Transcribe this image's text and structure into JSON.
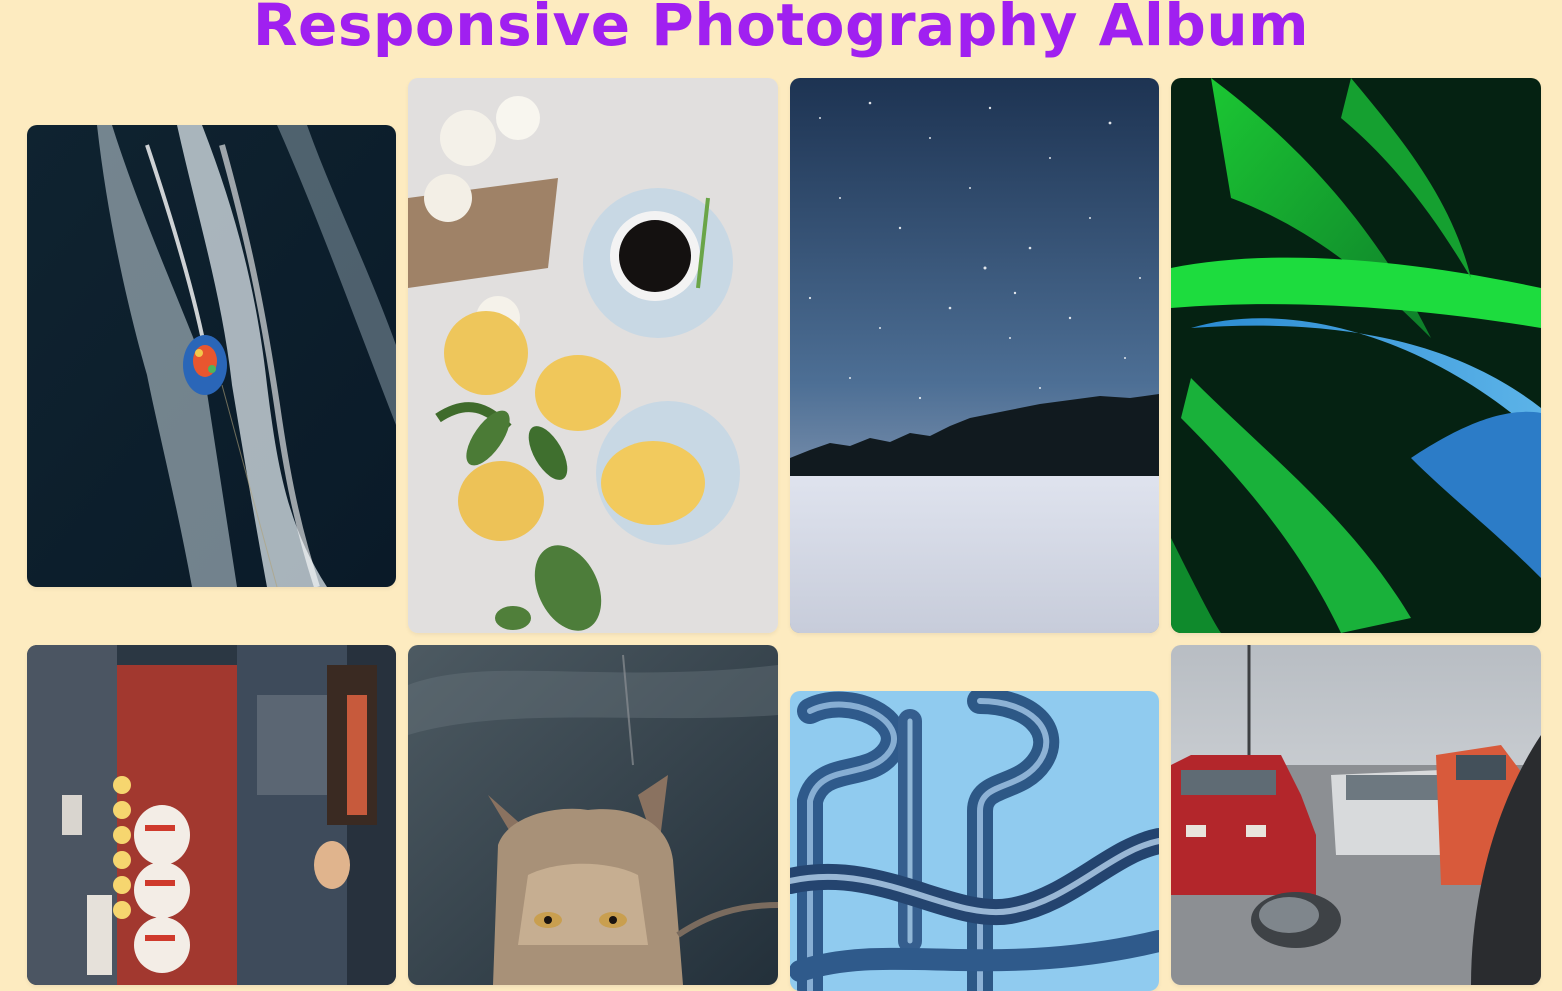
{
  "page": {
    "title": "Responsive Photography Album",
    "title_color": "#a020f0",
    "background_color": "#fdebc0"
  },
  "gallery": {
    "photos": [
      {
        "subject": "aerial view of a speedboat leaving white wakes on dark water"
      },
      {
        "subject": "flat lay of coffee cup, lemons, leaves and white flowers on a linen cloth"
      },
      {
        "subject": "starry night sky above a dark treeline and snowy field"
      },
      {
        "subject": "close-up of green tropical banana leaves under blue light"
      },
      {
        "subject": "city street with lantern signs on Japanese storefronts"
      },
      {
        "subject": "lynx sitting in front of a dark blurred background"
      },
      {
        "subject": "abstract glossy blue bent tubes on a light blue background"
      },
      {
        "subject": "parked cars with a red BMW beside a car side mirror"
      }
    ]
  }
}
